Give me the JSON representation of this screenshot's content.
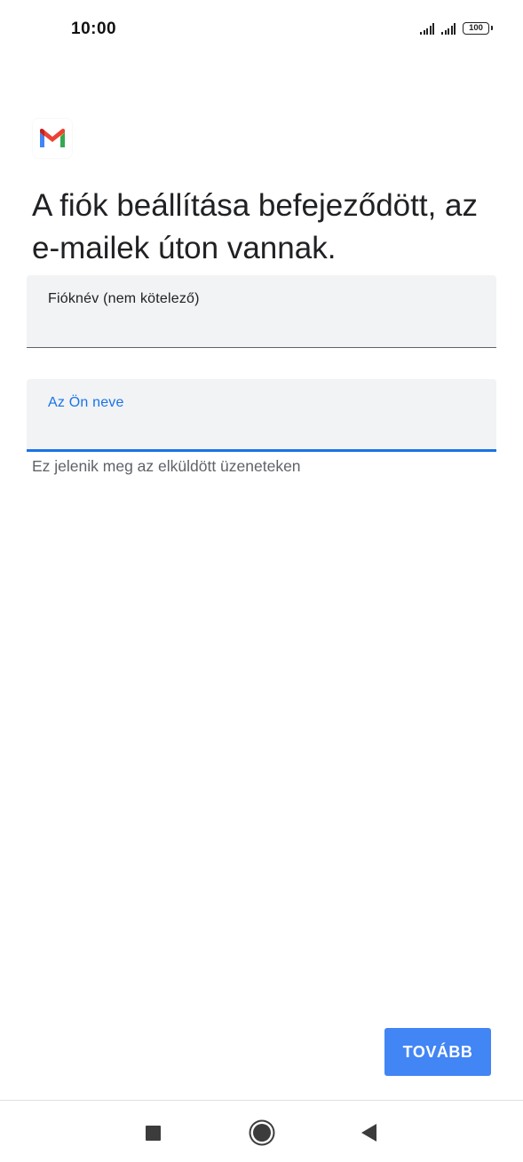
{
  "status_bar": {
    "time": "10:00",
    "battery_level": "100",
    "icons": [
      "signal-icon",
      "signal-icon",
      "battery-icon"
    ]
  },
  "app": {
    "logo_icon": "gmail-logo-icon",
    "heading": "A fiók beállítása befejeződött, az e-mailek úton vannak."
  },
  "form": {
    "account_name": {
      "label": "Fióknév (nem kötelező)",
      "value": ""
    },
    "your_name": {
      "label": "Az Ön neve",
      "value": "",
      "helper": "Ez jelenik meg az elküldött üzeneteken"
    }
  },
  "actions": {
    "next_label": "TOVÁBB"
  },
  "colors": {
    "accent": "#1a73e8",
    "button": "#4285f4",
    "field_bg": "#f1f3f4"
  },
  "nav_bar": {
    "icons": [
      "recent-apps-icon",
      "home-icon",
      "back-icon"
    ]
  }
}
